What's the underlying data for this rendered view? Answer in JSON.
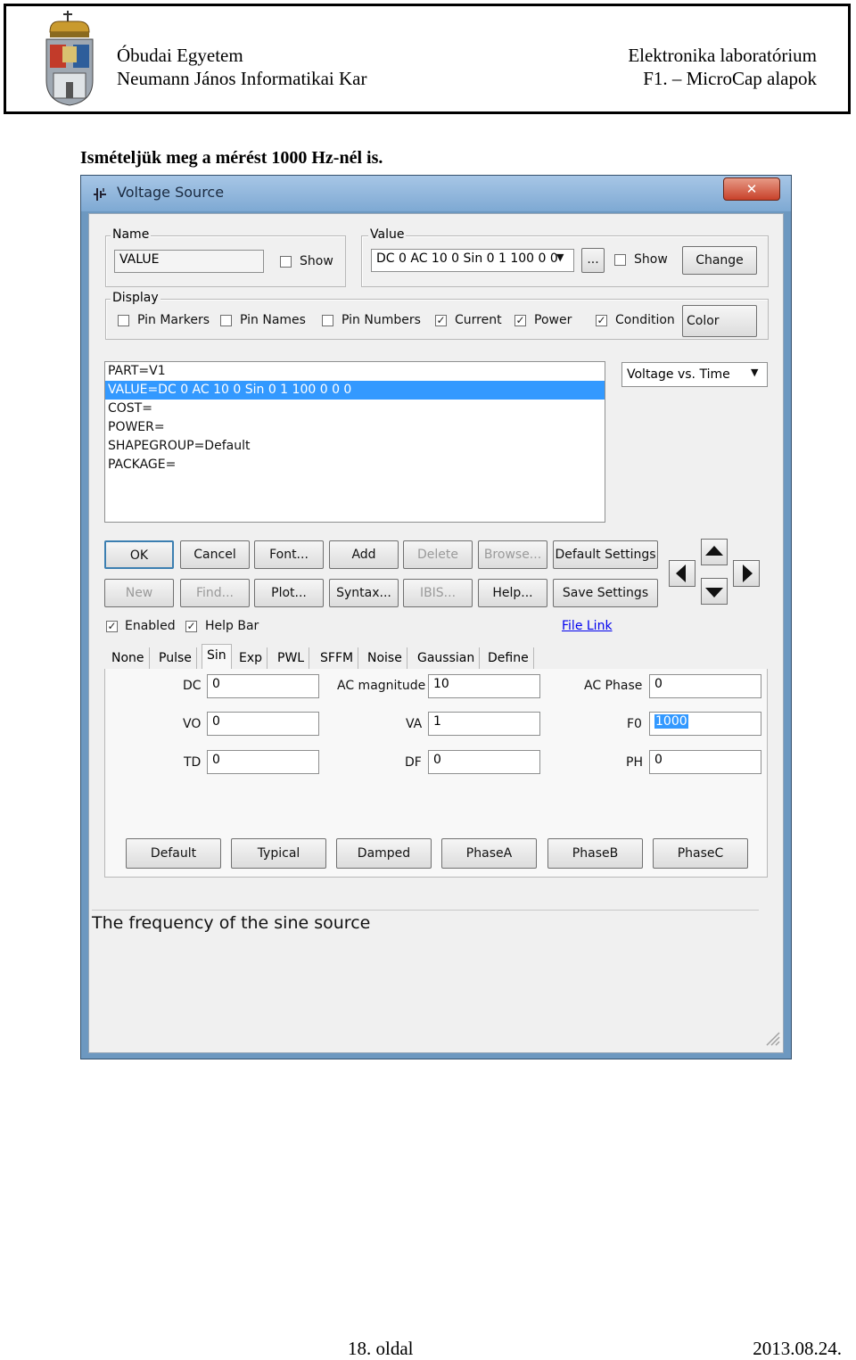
{
  "header": {
    "university": "Óbudai Egyetem",
    "faculty": "Neumann János Informatikai Kar",
    "course": "Elektronika laboratórium",
    "topic": "F1. – MicroCap alapok"
  },
  "intro_text": "Ismételjük meg a mérést 1000 Hz-nél is.",
  "dialog": {
    "title": "Voltage Source",
    "close_glyph": "✕",
    "name_group": {
      "legend": "Name",
      "value": "VALUE",
      "show_label": "Show",
      "show_checked": false
    },
    "value_group": {
      "legend": "Value",
      "value": "DC 0 AC 10 0 Sin 0 1 100 0 0",
      "ellipsis_label": "...",
      "show_label": "Show",
      "show_checked": false,
      "change_label": "Change"
    },
    "display_group": {
      "legend": "Display",
      "items": [
        {
          "label": "Pin Markers",
          "checked": false
        },
        {
          "label": "Pin Names",
          "checked": false
        },
        {
          "label": "Pin Numbers",
          "checked": false
        },
        {
          "label": "Current",
          "checked": true
        },
        {
          "label": "Power",
          "checked": true
        },
        {
          "label": "Condition",
          "checked": true
        }
      ],
      "color_label": "Color"
    },
    "attributes": [
      "PART=V1",
      "VALUE=DC 0 AC 10 0 Sin 0 1 100 0 0 0",
      "COST=",
      "POWER=",
      "SHAPEGROUP=Default",
      "PACKAGE="
    ],
    "selected_attribute_index": 1,
    "plot_select": "Voltage vs. Time",
    "buttons_row1": [
      {
        "label": "OK",
        "enabled": true
      },
      {
        "label": "Cancel",
        "enabled": true
      },
      {
        "label": "Font...",
        "enabled": true
      },
      {
        "label": "Add",
        "enabled": true
      },
      {
        "label": "Delete",
        "enabled": false
      },
      {
        "label": "Browse...",
        "enabled": false
      },
      {
        "label": "Default Settings",
        "enabled": true
      }
    ],
    "buttons_row2": [
      {
        "label": "New",
        "enabled": false
      },
      {
        "label": "Find...",
        "enabled": false
      },
      {
        "label": "Plot...",
        "enabled": true
      },
      {
        "label": "Syntax...",
        "enabled": true
      },
      {
        "label": "IBIS...",
        "enabled": false
      },
      {
        "label": "Help...",
        "enabled": true
      },
      {
        "label": "Save Settings",
        "enabled": true
      }
    ],
    "enabled_label": "Enabled",
    "enabled_checked": true,
    "helpbar_label": "Help Bar",
    "helpbar_checked": true,
    "file_link": "File Link",
    "tabs": [
      "None",
      "Pulse",
      "Sin",
      "Exp",
      "PWL",
      "SFFM",
      "Noise",
      "Gaussian",
      "Define"
    ],
    "active_tab": "Sin",
    "params": [
      {
        "label": "DC",
        "value": "0"
      },
      {
        "label": "AC magnitude",
        "value": "10"
      },
      {
        "label": "AC Phase",
        "value": "0"
      },
      {
        "label": "VO",
        "value": "0"
      },
      {
        "label": "VA",
        "value": "1"
      },
      {
        "label": "F0",
        "value": "1000"
      },
      {
        "label": "TD",
        "value": "0"
      },
      {
        "label": "DF",
        "value": "0"
      },
      {
        "label": "PH",
        "value": "0"
      }
    ],
    "preset_buttons": [
      "Default",
      "Typical",
      "Damped",
      "PhaseA",
      "PhaseB",
      "PhaseC"
    ],
    "help_text": "The frequency of the sine source"
  },
  "footer": {
    "page": "18. oldal",
    "date": "2013.08.24."
  },
  "colors": {
    "selection": "#3399ff",
    "title_gradient_top": "#a7c6e6",
    "close_red": "#c8412a",
    "link": "#0000ee"
  }
}
